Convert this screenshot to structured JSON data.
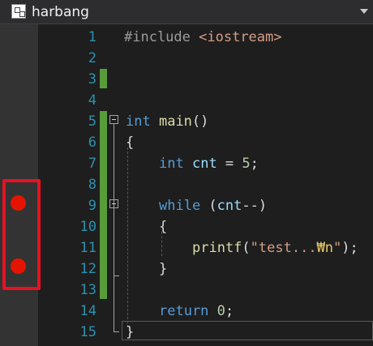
{
  "title": {
    "file_label": "harbang",
    "icon": "class-diagram-icon"
  },
  "line_numbers": [
    "1",
    "2",
    "3",
    "4",
    "5",
    "6",
    "7",
    "8",
    "9",
    "10",
    "11",
    "12",
    "13",
    "14",
    "15"
  ],
  "breakpoints": {
    "lines": [
      9,
      12
    ],
    "color": "#e51400",
    "highlight_color": "#e81123"
  },
  "code": {
    "l1_directive": "#include",
    "l1_header": "<iostream>",
    "l5_type": "int",
    "l5_name": "main",
    "l5_parens": "()",
    "l6_brace": "{",
    "l7_type": "int",
    "l7_var": "cnt",
    "l7_assign": " = ",
    "l7_num": "5",
    "l7_semi": ";",
    "l9_kw": "while",
    "l9_open": " (",
    "l9_var": "cnt",
    "l9_op": "--)",
    "l10_brace": "{",
    "l11_fn": "printf",
    "l11_open": "(",
    "l11_str": "\"test...",
    "l11_esc": "₩n",
    "l11_strend": "\"",
    "l11_close": ");",
    "l12_brace": "}",
    "l14_kw": "return",
    "l14_space": " ",
    "l14_num": "0",
    "l14_semi": ";",
    "l15_brace": "}"
  },
  "colors": {
    "editor_bg": "#1e1e1e",
    "line_number": "#2b91af",
    "keyword": "#569cd6",
    "function": "#dcdcaa",
    "variable": "#9cdcfe",
    "number": "#b5cea8",
    "string": "#d69d85",
    "change_bar": "#579b3b"
  }
}
